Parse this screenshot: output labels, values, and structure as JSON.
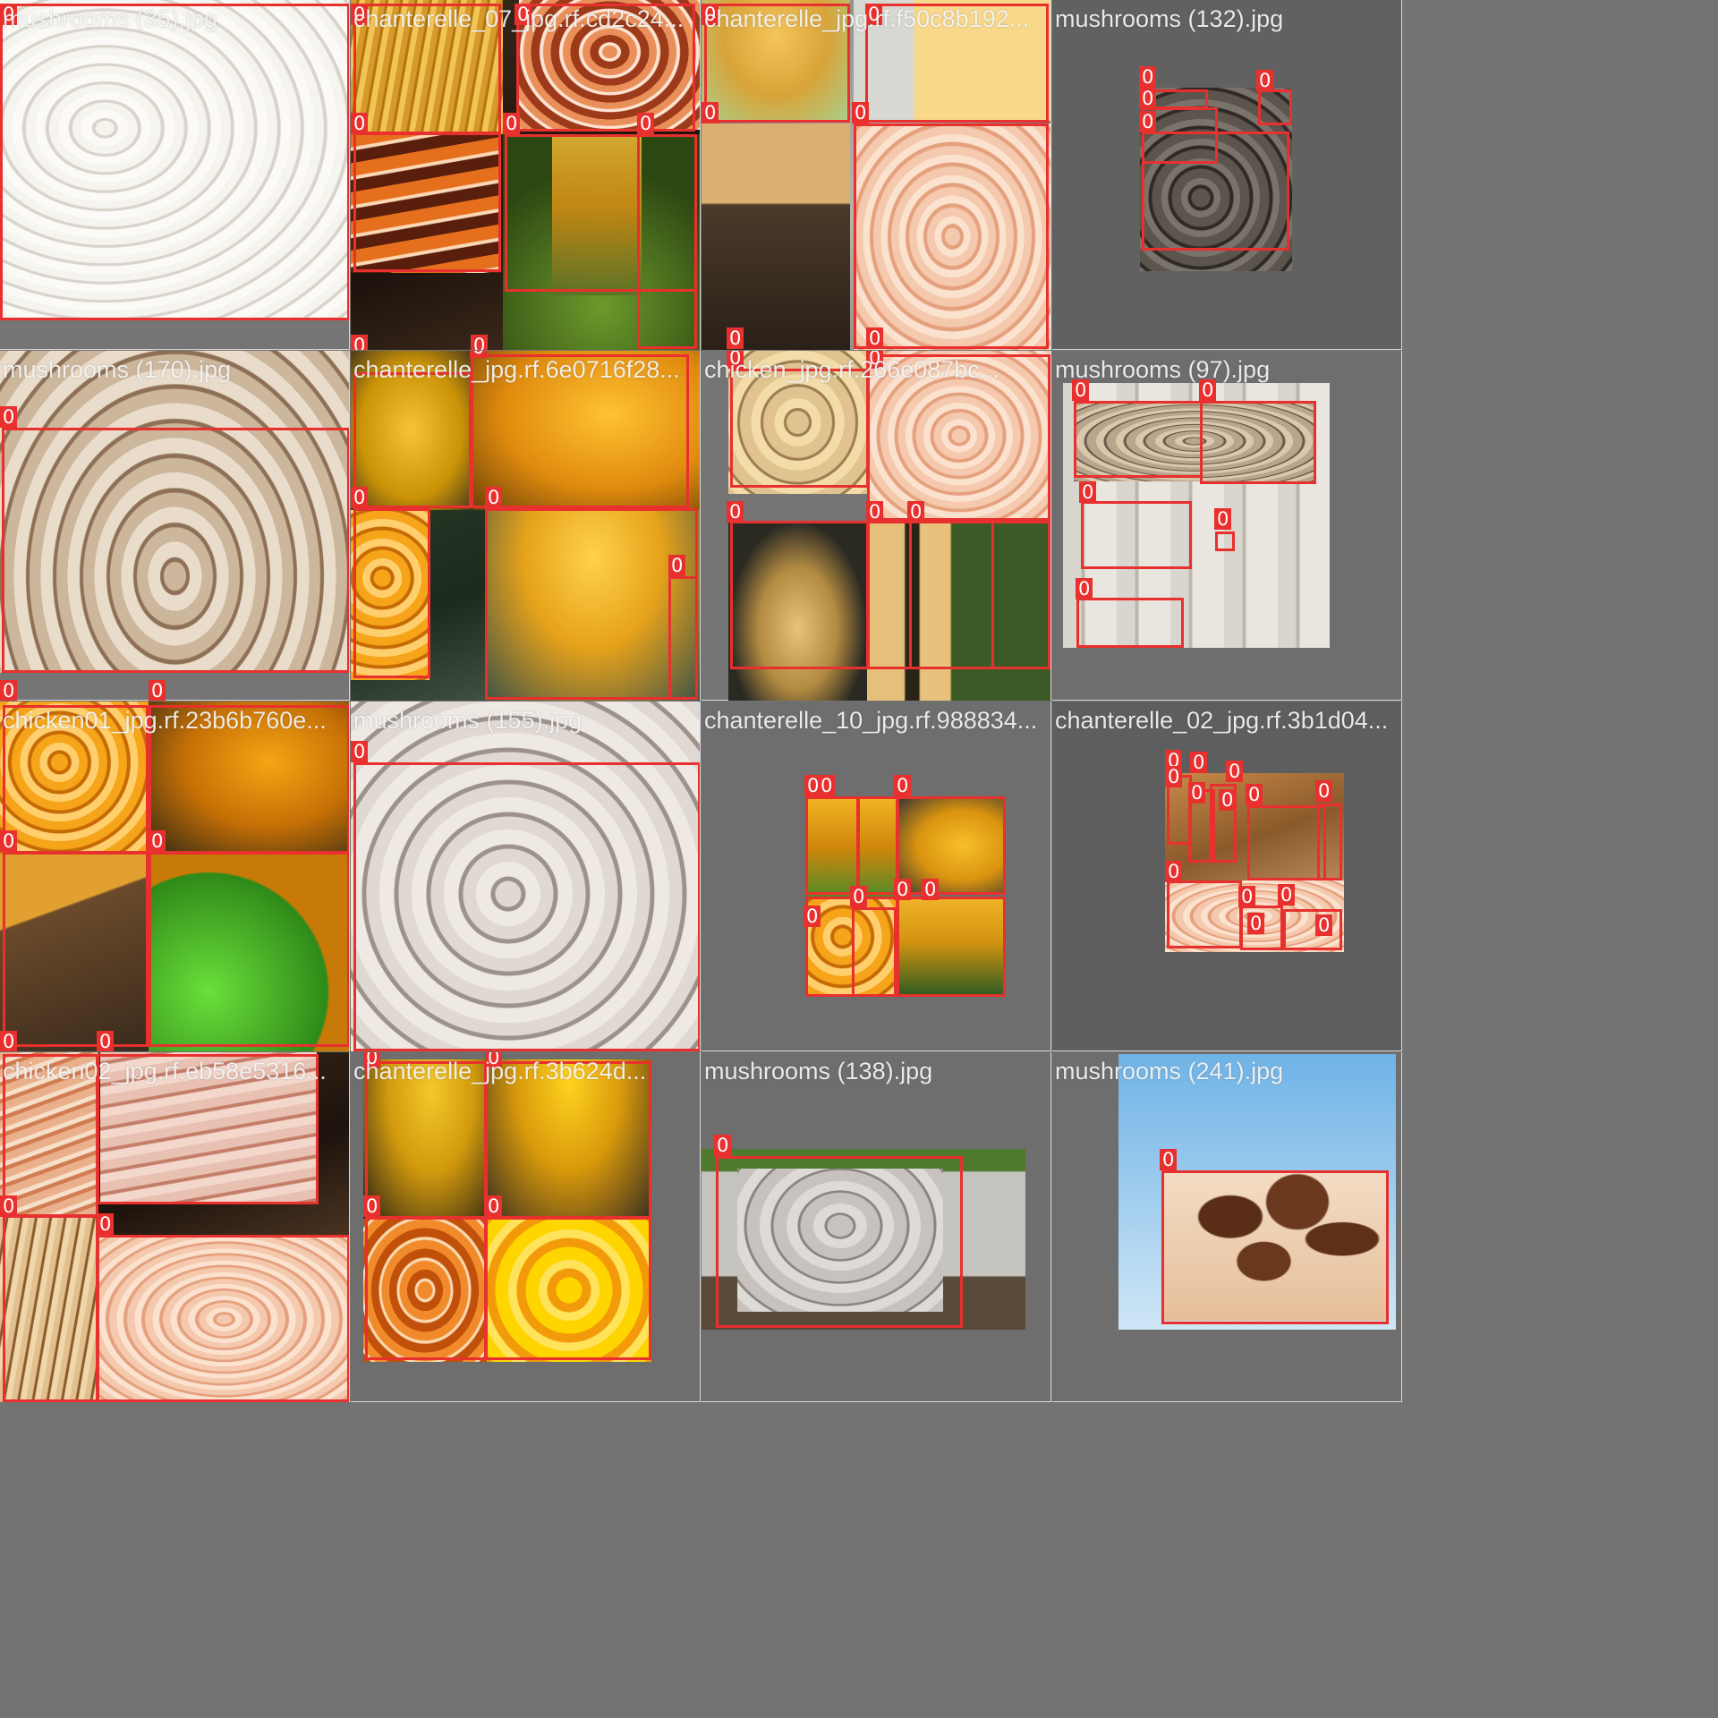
{
  "grid": {
    "cells": [
      {
        "filename": "mushrooms (35).jpg",
        "class_label": "0"
      },
      {
        "filename": "chanterelle_07_jpg.rf.cd2c24...",
        "class_label": "0"
      },
      {
        "filename": "chanterelle_jpg.rf.f50c8b192...",
        "class_label": "0"
      },
      {
        "filename": "mushrooms (132).jpg",
        "class_label": "0"
      },
      {
        "filename": "mushrooms (170).jpg",
        "class_label": "0"
      },
      {
        "filename": "chanterelle_jpg.rf.6e0716f28...",
        "class_label": "0"
      },
      {
        "filename": "chicken_jpg.rf.266e087bc...",
        "class_label": "0"
      },
      {
        "filename": "mushrooms (97).jpg",
        "class_label": "0"
      },
      {
        "filename": "chicken01_jpg.rf.23b6b760e...",
        "class_label": "0"
      },
      {
        "filename": "mushrooms (155).jpg",
        "class_label": "0"
      },
      {
        "filename": "chanterelle_10_jpg.rf.988834...",
        "class_label": "0"
      },
      {
        "filename": "chanterelle_02_jpg.rf.3b1d04...",
        "class_label": "0"
      },
      {
        "filename": "chicken02_jpg.rf.eb58e5316...",
        "class_label": "0"
      },
      {
        "filename": "chanterelle_jpg.rf.3b624d...",
        "class_label": "0"
      },
      {
        "filename": "mushrooms (138).jpg",
        "class_label": "0"
      },
      {
        "filename": "mushrooms (241).jpg",
        "class_label": "0"
      }
    ]
  }
}
